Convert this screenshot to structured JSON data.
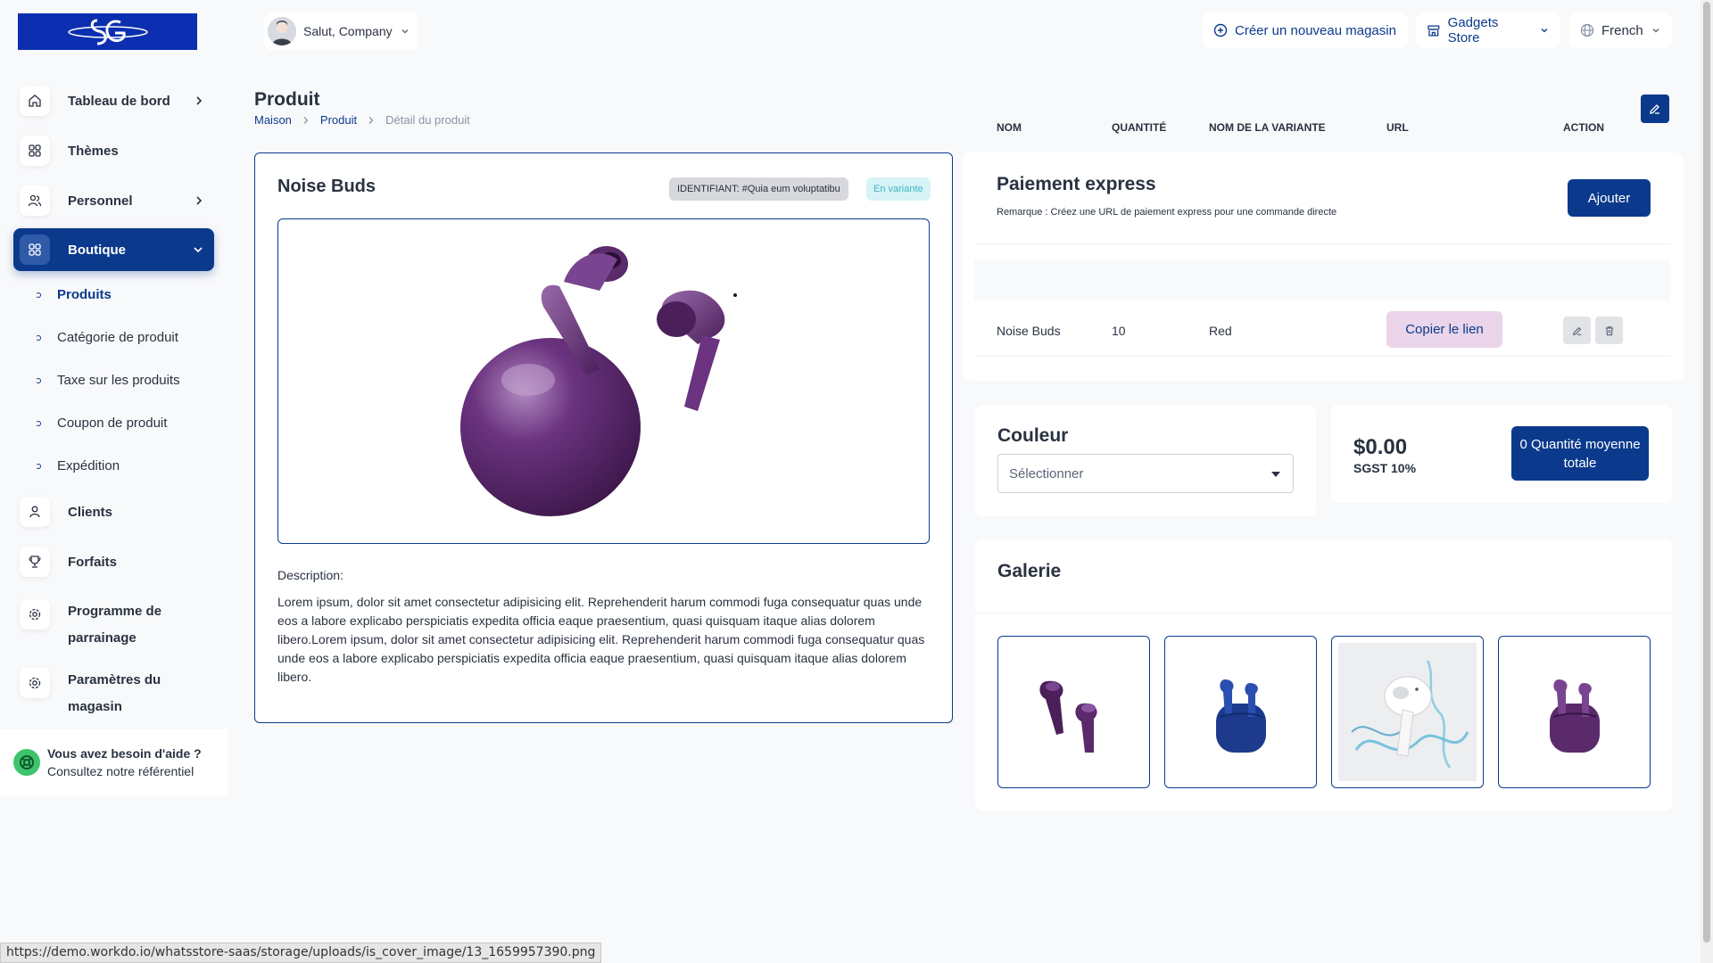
{
  "header": {
    "user_greeting": "Salut, Company",
    "create_store_label": "Créer un nouveau magasin",
    "store_label": "Gadgets Store",
    "language_label": "French"
  },
  "sidebar": {
    "items": [
      {
        "label": "Tableau de bord"
      },
      {
        "label": "Thèmes"
      },
      {
        "label": "Personnel"
      },
      {
        "label": "Boutique"
      },
      {
        "label": "Clients"
      },
      {
        "label": "Forfaits"
      },
      {
        "label": "Programme de parrainage"
      },
      {
        "label": "Paramètres du magasin"
      }
    ],
    "sub_items": [
      {
        "label": "Produits"
      },
      {
        "label": "Catégorie de produit"
      },
      {
        "label": "Taxe sur les produits"
      },
      {
        "label": "Coupon de produit"
      },
      {
        "label": "Expédition"
      }
    ],
    "help_title": "Vous avez besoin d'aide ?",
    "help_sub": "Consultez notre référentiel"
  },
  "page": {
    "title": "Produit",
    "breadcrumb": [
      "Maison",
      "Produit",
      "Détail du produit"
    ]
  },
  "product": {
    "name": "Noise Buds",
    "id_badge": "IDENTIFIANT: #Quia eum voluptatibu",
    "variant_badge": "En variante",
    "description_label": "Description:",
    "description": "Lorem ipsum, dolor sit amet consectetur adipisicing elit. Reprehenderit harum commodi fuga consequatur quas unde eos a labore explicabo perspiciatis expedita officia eaque praesentium, quasi quisquam itaque alias dolorem libero.Lorem ipsum, dolor sit amet consectetur adipisicing elit. Reprehenderit harum commodi fuga consequatur quas unde eos a labore explicabo perspiciatis expedita officia eaque praesentium, quasi quisquam itaque alias dolorem libero."
  },
  "express": {
    "title": "Paiement express",
    "note": "Remarque : Créez une URL de paiement express pour une commande directe",
    "add_label": "Ajouter",
    "columns": [
      "NOM",
      "QUANTITÉ",
      "NOM DE LA VARIANTE",
      "URL",
      "ACTION"
    ],
    "rows": [
      {
        "name": "Noise Buds",
        "qty": "10",
        "variant": "Red",
        "url_label": "Copier le lien"
      }
    ]
  },
  "color": {
    "title": "Couleur",
    "select_value": "Sélectionner"
  },
  "price": {
    "value": "$0.00",
    "tax": "SGST 10%",
    "qty_label": "0 Quantité moyenne totale"
  },
  "gallery": {
    "title": "Galerie"
  },
  "status_url": "https://demo.workdo.io/whatsstore-saas/storage/uploads/is_cover_image/13_1659957390.png",
  "colors": {
    "primary": "#0b3a8c",
    "product_purple": "#5a2a6b",
    "product_blue": "#1d3a8c"
  }
}
